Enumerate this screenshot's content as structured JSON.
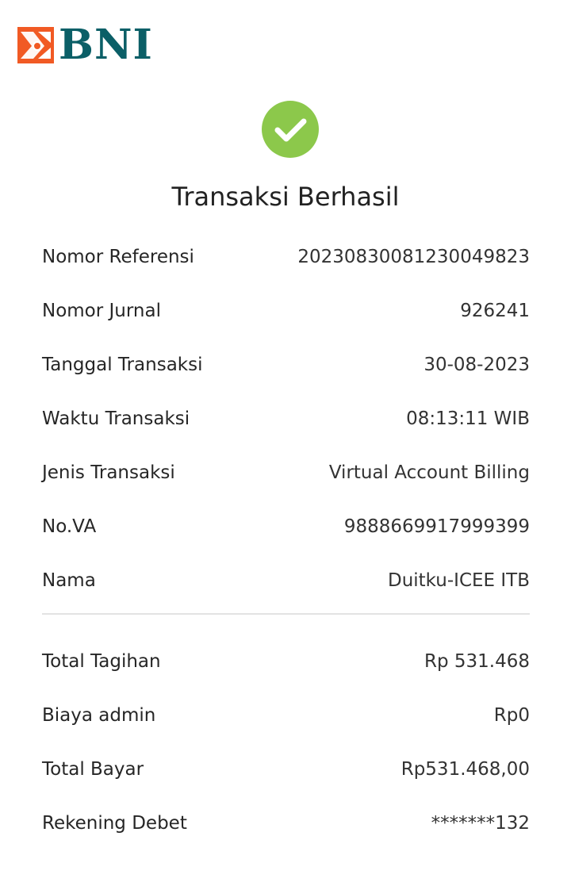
{
  "brand": {
    "name": "BNI",
    "primary_color": "#0b5f67",
    "accent_color": "#f15a24",
    "logo_icon": "bni-sail-icon"
  },
  "status": {
    "icon": "check-circle-icon",
    "color": "#8cc84b",
    "title": "Transaksi Berhasil"
  },
  "details": [
    {
      "label": "Nomor Referensi",
      "value": "20230830081230049823"
    },
    {
      "label": "Nomor Jurnal",
      "value": "926241"
    },
    {
      "label": "Tanggal Transaksi",
      "value": "30-08-2023"
    },
    {
      "label": "Waktu Transaksi",
      "value": "08:13:11 WIB"
    },
    {
      "label": "Jenis Transaksi",
      "value": "Virtual Account Billing"
    },
    {
      "label": "No.VA",
      "value": "9888669917999399"
    },
    {
      "label": "Nama",
      "value": "Duitku-ICEE ITB"
    }
  ],
  "summary": [
    {
      "label": "Total Tagihan",
      "value": "Rp 531.468"
    },
    {
      "label": "Biaya admin",
      "value": "Rp0"
    },
    {
      "label": "Total Bayar",
      "value": "Rp531.468,00"
    },
    {
      "label": "Rekening Debet",
      "value": "*******132"
    }
  ]
}
